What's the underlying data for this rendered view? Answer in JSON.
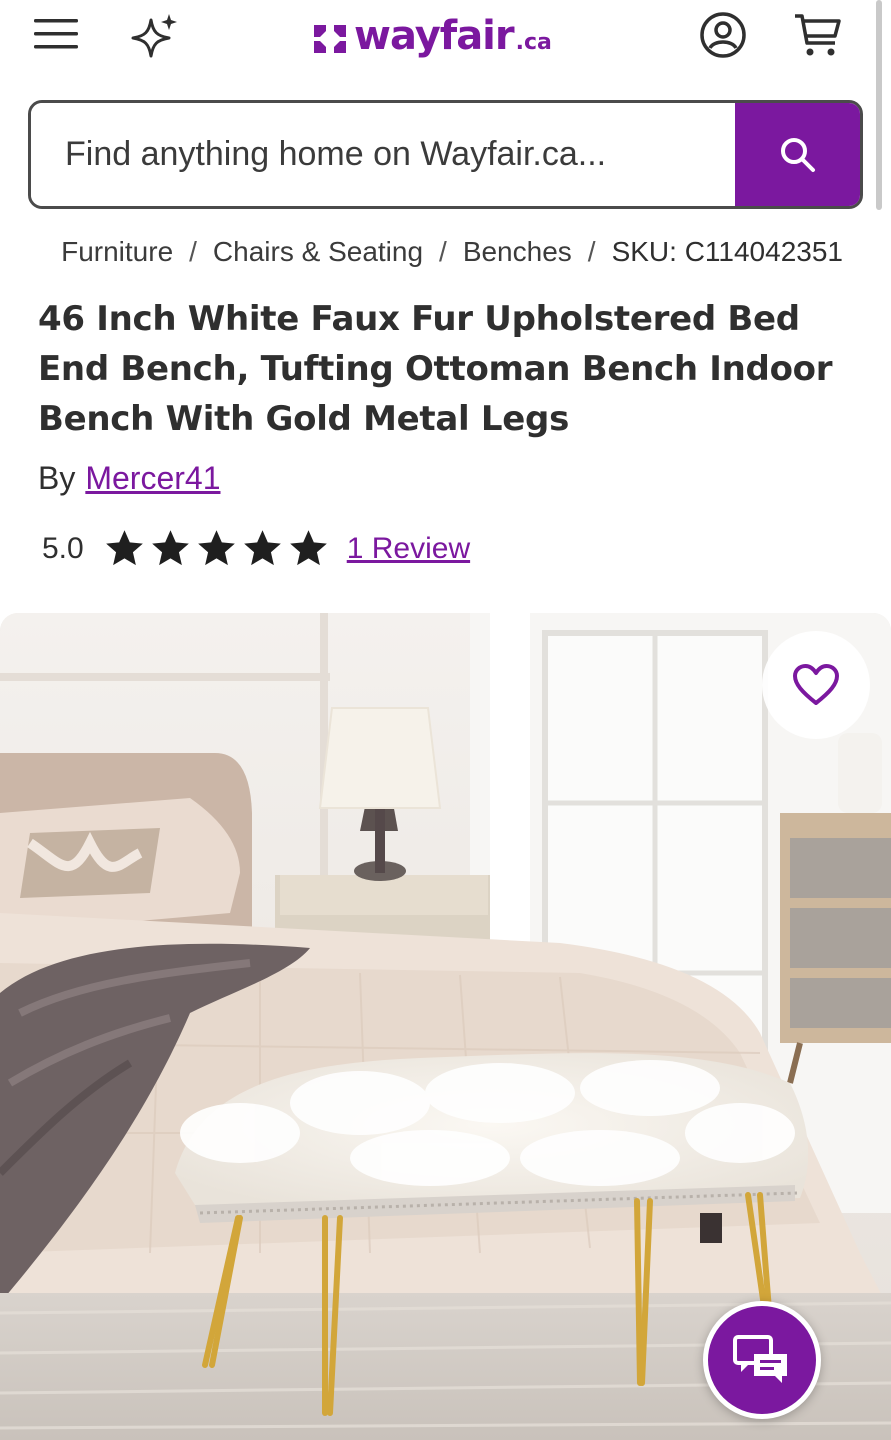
{
  "header": {
    "logo_text": "wayfair",
    "logo_tld": ".ca",
    "icons": [
      "menu-icon",
      "sparkle-icon",
      "account-icon",
      "cart-icon"
    ]
  },
  "search": {
    "placeholder": "Find anything home on Wayfair.ca...",
    "button_icon": "search-icon"
  },
  "breadcrumb": {
    "items": [
      "Furniture",
      "Chairs & Seating",
      "Benches"
    ],
    "separator": "/",
    "sku": "SKU: C114042351"
  },
  "product": {
    "title": "46 Inch White Faux Fur Upholstered Bed End Bench, Tufting Ottoman Bench Indoor Bench With Gold Metal Legs",
    "by_label": "By",
    "brand": "Mercer41",
    "rating": "5.0",
    "stars": 5,
    "reviews_label": "1 Review"
  },
  "gallery": {
    "favorite_icon": "heart-icon",
    "chat_icon": "chat-icon"
  },
  "colors": {
    "brand_purple": "#7b189f",
    "text": "#2f2f2f"
  }
}
